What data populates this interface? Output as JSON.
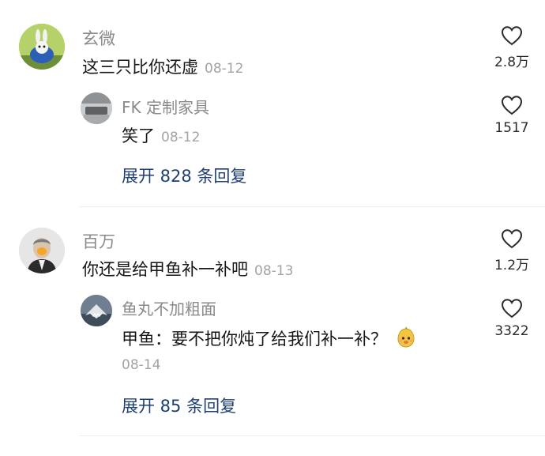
{
  "comments": [
    {
      "user": "玄微",
      "text": "这三只比你还虚",
      "date": "08-12",
      "likes": "2.8万",
      "reply": {
        "user": "FK 定制家具",
        "text": "笑了",
        "date": "08-12",
        "likes": "1517"
      },
      "expand_label": "展开 828 条回复"
    },
    {
      "user": "百万",
      "text": "你还是给甲鱼补一补吧",
      "date": "08-13",
      "likes": "1.2万",
      "reply": {
        "user": "鱼丸不加粗面",
        "text": "甲鱼：要不把你炖了给我们补一补？",
        "date": "08-14",
        "likes": "3322",
        "emoji": "pear-face-emoji"
      },
      "expand_label": "展开 85 条回复"
    }
  ],
  "icons": {
    "like": "heart-outline-icon"
  },
  "colors": {
    "username": "#8a8a8a",
    "text": "#161616",
    "date": "#a3a3a3",
    "expand": "#1f3f73",
    "divider": "#eeeeee"
  }
}
